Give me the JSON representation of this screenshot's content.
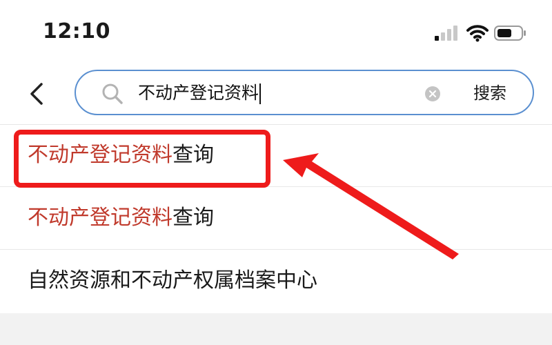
{
  "status_bar": {
    "time": "12:10",
    "icons": [
      "signal-icon",
      "wifi-icon",
      "battery-icon"
    ]
  },
  "search": {
    "query": "不动产登记资料",
    "button_label": "搜索",
    "icons": [
      "back-icon",
      "search-icon",
      "clear-icon"
    ]
  },
  "results": [
    {
      "highlight": "不动产登记资料",
      "rest": "查询"
    },
    {
      "highlight": "不动产登记资料",
      "rest": "查询"
    },
    {
      "highlight": "",
      "rest": "自然资源和不动产权属档案中心"
    }
  ],
  "colors": {
    "highlight_text": "#c0392b",
    "annotation_red": "#ee1b1b",
    "search_border": "#5a8fd0"
  }
}
